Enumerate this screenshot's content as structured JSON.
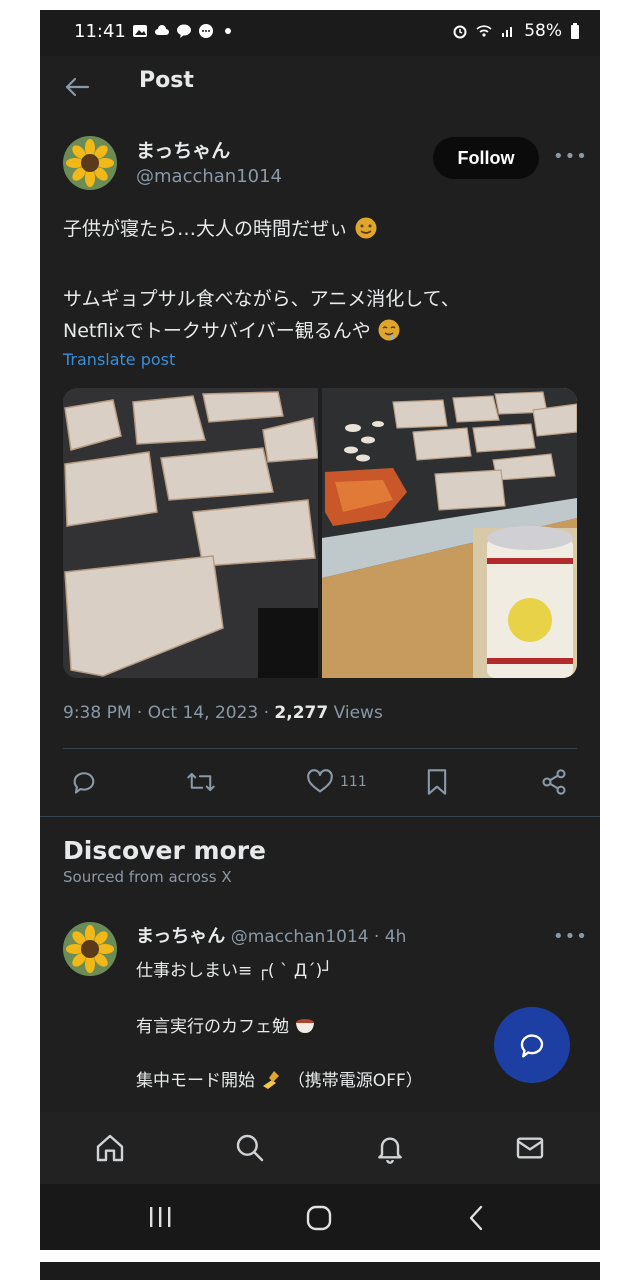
{
  "status_bar": {
    "time": "11:41",
    "battery": "58%"
  },
  "header": {
    "title": "Post"
  },
  "post": {
    "author_name": "まっちゃん",
    "author_handle": "@macchan1014",
    "follow_label": "Follow",
    "text_line1": "子供が寝たら…大人の時間だぜぃ",
    "text_line2": "サムギョプサル食べながら、アニメ消化して、",
    "text_line3": "Netflixでトークサバイバー観るんや",
    "translate_label": "Translate post",
    "time": "9:38 PM · Oct 14, 2023 · ",
    "views_count": "2,277",
    "views_label": " Views",
    "like_count": "111"
  },
  "discover": {
    "title": "Discover more",
    "subtitle": "Sourced from across X"
  },
  "tweet2": {
    "author_name": "まっちゃん",
    "meta": "@macchan1014 · 4h",
    "line1": "仕事おしまい≡ ┌( ˋ Д´)┘",
    "line2": "有言実行のカフェ勉",
    "line3": "集中モード開始",
    "line3_suffix": "（携帯電源OFF）"
  },
  "icons": [
    "back-arrow-icon",
    "reply-icon",
    "retweet-icon",
    "heart-icon",
    "bookmark-icon",
    "share-icon",
    "home-icon",
    "search-icon",
    "bell-icon",
    "mail-icon",
    "compose-icon"
  ],
  "colors": {
    "background": "#1f1f1f",
    "link": "#3a8fd9",
    "fab": "#1d3fa3",
    "muted": "#8b98a5"
  }
}
